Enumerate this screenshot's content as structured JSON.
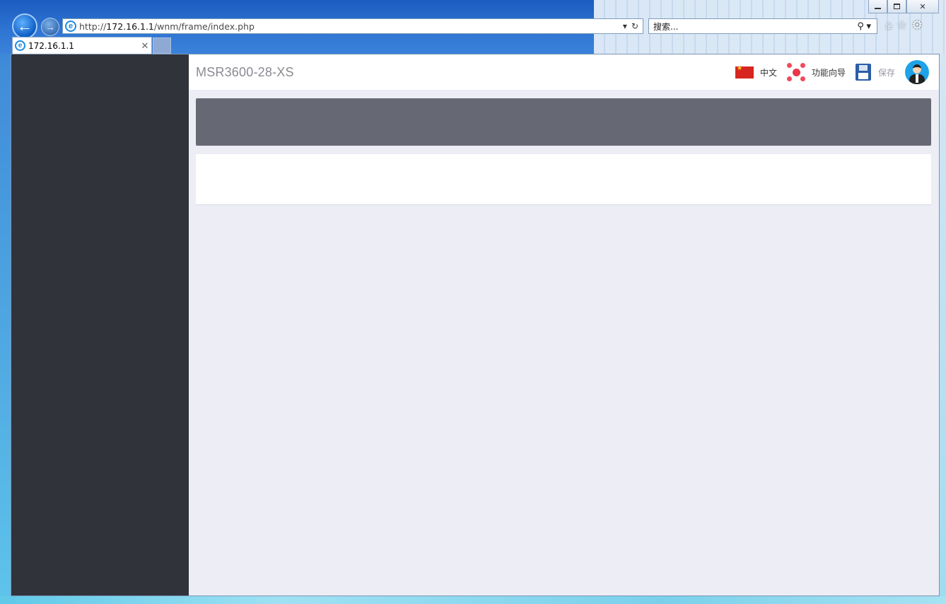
{
  "browser": {
    "url_prefix": "http://",
    "url_host": "172.16.1.1",
    "url_path": "/wnm/frame/index.php",
    "search_placeholder": "搜索...",
    "tab_title": "172.16.1.1",
    "tab_close": "✕",
    "window_controls": [
      "minimize-icon",
      "maximize-icon",
      "close-icon"
    ]
  },
  "header": {
    "device_title": "MSR3600-28-XS",
    "language_label": "中文",
    "wizard_label": "功能向导",
    "save_label": "保存"
  },
  "colors": {
    "sidebar": "#31333b",
    "banner": "#666874",
    "content_bg": "#ecedf5",
    "accent_flag": "#d7261f"
  }
}
